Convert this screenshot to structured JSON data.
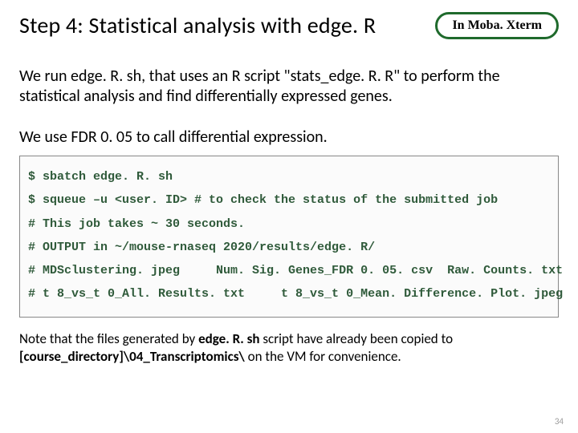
{
  "header": {
    "title": "Step 4: Statistical analysis with edge. R",
    "badge": "In Moba. Xterm"
  },
  "paragraph1": "We run edge. R. sh, that uses an R script \"stats_edge. R. R\" to perform the statistical analysis and find differentially expressed genes.",
  "paragraph2": "We use FDR 0. 05 to call differential expression.",
  "code": {
    "line1": "$ sbatch edge. R. sh",
    "line2": "$ squeue –u <user. ID> # to check the status of the submitted job",
    "line3": "# This job takes ~ 30 seconds.",
    "line4": "# OUTPUT in ~/mouse-rnaseq 2020/results/edge. R/",
    "line5": "# MDSclustering. jpeg     Num. Sig. Genes_FDR 0. 05. csv  Raw. Counts. txt",
    "line6": "# t 8_vs_t 0_All. Results. txt     t 8_vs_t 0_Mean. Difference. Plot. jpeg"
  },
  "footnote": {
    "part1": "Note that the files generated by ",
    "bold1": "edge. R. sh",
    "part2": " script have already been copied to ",
    "bold2": "[course_directory]\\04_Transcriptomics\\",
    "part3": " on the VM for convenience."
  },
  "pagenum": "34"
}
